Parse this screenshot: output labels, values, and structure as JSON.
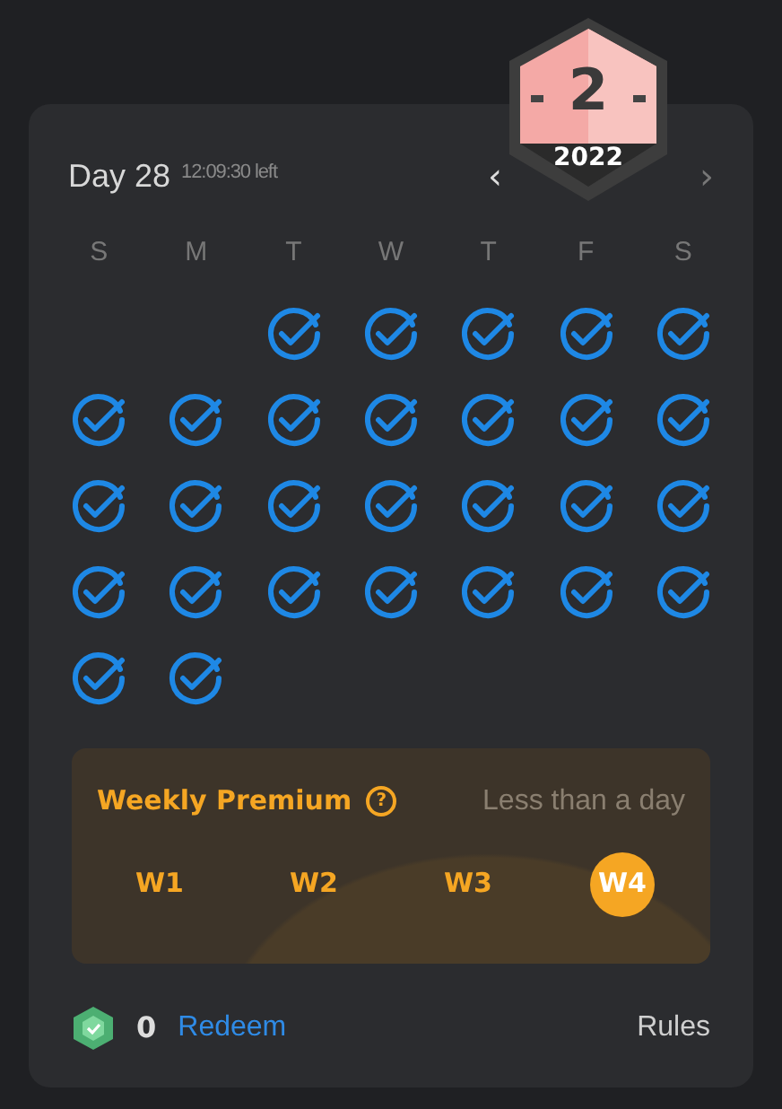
{
  "header": {
    "title": "Day 28",
    "countdown": "12:09:30 left",
    "prev": "‹",
    "next": "›"
  },
  "badge": {
    "number": "2",
    "year": "2022"
  },
  "weekdays": [
    "S",
    "M",
    "T",
    "W",
    "T",
    "F",
    "S"
  ],
  "days": [
    {
      "kind": "empty"
    },
    {
      "kind": "empty"
    },
    {
      "kind": "day",
      "checked": true
    },
    {
      "kind": "day",
      "checked": true
    },
    {
      "kind": "day",
      "checked": true
    },
    {
      "kind": "day",
      "checked": true
    },
    {
      "kind": "day",
      "checked": true
    },
    {
      "kind": "day",
      "checked": true
    },
    {
      "kind": "day",
      "checked": true
    },
    {
      "kind": "day",
      "checked": true
    },
    {
      "kind": "day",
      "checked": true
    },
    {
      "kind": "day",
      "checked": true
    },
    {
      "kind": "day",
      "checked": true
    },
    {
      "kind": "day",
      "checked": true
    },
    {
      "kind": "day",
      "checked": true
    },
    {
      "kind": "day",
      "checked": true
    },
    {
      "kind": "day",
      "checked": true
    },
    {
      "kind": "day",
      "checked": true
    },
    {
      "kind": "day",
      "checked": true
    },
    {
      "kind": "day",
      "checked": true
    },
    {
      "kind": "day",
      "checked": true
    },
    {
      "kind": "day",
      "checked": true
    },
    {
      "kind": "day",
      "checked": true
    },
    {
      "kind": "day",
      "checked": true
    },
    {
      "kind": "day",
      "checked": true
    },
    {
      "kind": "day",
      "checked": true
    },
    {
      "kind": "day",
      "checked": true
    },
    {
      "kind": "day",
      "checked": true
    },
    {
      "kind": "day",
      "checked": true
    },
    {
      "kind": "day",
      "checked": true
    }
  ],
  "premium": {
    "title": "Weekly Premium",
    "help": "?",
    "remaining": "Less than a day",
    "weeks": [
      {
        "label": "W1",
        "selected": false
      },
      {
        "label": "W2",
        "selected": false
      },
      {
        "label": "W3",
        "selected": false
      },
      {
        "label": "W4",
        "selected": true
      }
    ]
  },
  "footer": {
    "points": "0",
    "redeem": "Redeem",
    "rules": "Rules"
  }
}
